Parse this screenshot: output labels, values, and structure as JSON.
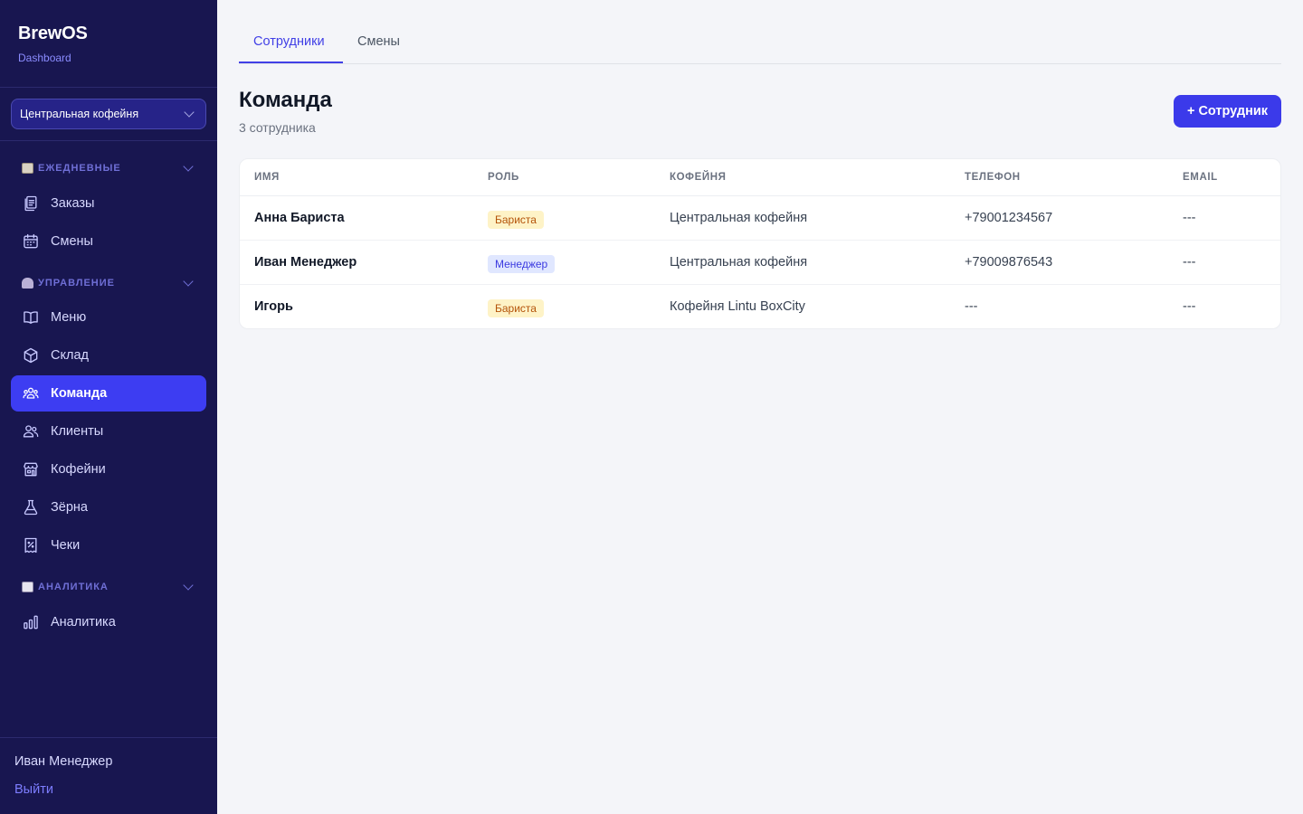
{
  "app": {
    "brand": "BrewOS",
    "subtitle": "Dashboard"
  },
  "sidebar": {
    "store_select": "Центральная кофейня",
    "sections": [
      {
        "label": "ЕЖЕДНЕВНЫЕ",
        "icon": "clipboard-emoji"
      },
      {
        "label": "УПРАВЛЕНИЕ",
        "icon": "manager-emoji"
      },
      {
        "label": "АНАЛИТИКА",
        "icon": "bar-chart-emoji"
      }
    ],
    "items": [
      {
        "label": "Заказы",
        "icon": "orders-icon"
      },
      {
        "label": "Смены",
        "icon": "calendar-icon"
      },
      {
        "label": "Меню",
        "icon": "book-icon"
      },
      {
        "label": "Склад",
        "icon": "box-icon"
      },
      {
        "label": "Команда",
        "icon": "team-icon"
      },
      {
        "label": "Клиенты",
        "icon": "users-icon"
      },
      {
        "label": "Кофейни",
        "icon": "store-icon"
      },
      {
        "label": "Зёрна",
        "icon": "flask-icon"
      },
      {
        "label": "Чеки",
        "icon": "receipt-icon"
      },
      {
        "label": "Аналитика",
        "icon": "analytics-icon"
      }
    ],
    "active_item": "Команда",
    "user_name": "Иван Менеджер",
    "logout": "Выйти"
  },
  "tabs": [
    {
      "label": "Сотрудники",
      "active": true
    },
    {
      "label": "Смены",
      "active": false
    }
  ],
  "page": {
    "title": "Команда",
    "subtitle": "3 сотрудника",
    "add_button": "+ Сотрудник"
  },
  "table": {
    "columns": [
      "Имя",
      "Роль",
      "Кофейня",
      "Телефон",
      "Email"
    ],
    "rows": [
      {
        "name": "Анна Бариста",
        "role": "Бариста",
        "role_type": "barista",
        "store": "Центральная кофейня",
        "phone": "+79001234567",
        "email": "---"
      },
      {
        "name": "Иван Менеджер",
        "role": "Менеджер",
        "role_type": "manager",
        "store": "Центральная кофейня",
        "phone": "+79009876543",
        "email": "---"
      },
      {
        "name": "Игорь",
        "role": "Бариста",
        "role_type": "barista",
        "store": "Кофейня Lintu BoxCity",
        "phone": "---",
        "email": "---"
      }
    ]
  },
  "colors": {
    "sidebar_bg": "#181650",
    "accent": "#3b3aea",
    "barista_badge_bg": "#fef3c7",
    "barista_badge_text": "#b45309",
    "manager_badge_bg": "#e0e7ff",
    "manager_badge_text": "#3b3ae0"
  }
}
